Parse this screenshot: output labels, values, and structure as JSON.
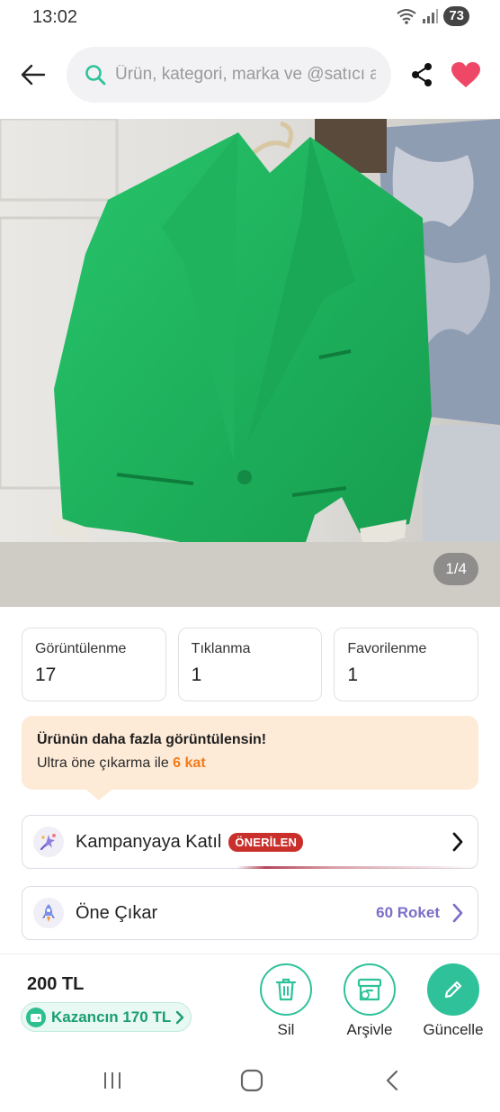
{
  "status_bar": {
    "time": "13:02",
    "battery": "73"
  },
  "header": {
    "search_placeholder": "Ürün, kategori, marka ve @satıcı ara"
  },
  "photo": {
    "counter": "1/4"
  },
  "stats": [
    {
      "label": "Görüntülenme",
      "value": "17"
    },
    {
      "label": "Tıklanma",
      "value": "1"
    },
    {
      "label": "Favorilenme",
      "value": "1"
    }
  ],
  "promo": {
    "title": "Ürünün daha fazla görüntülensin!",
    "subtitle_prefix": "Ultra öne çıkarma ile ",
    "subtitle_highlight": "6 kat"
  },
  "campaign": {
    "label": "Kampanyaya Katıl",
    "badge": "ÖNERİLEN"
  },
  "boost": {
    "label": "Öne Çıkar",
    "value": "60 Roket"
  },
  "bottom": {
    "price": "200 TL",
    "earnings": "Kazancın 170 TL",
    "actions": {
      "delete": "Sil",
      "archive": "Arşivle",
      "update": "Güncelle"
    }
  },
  "colors": {
    "accent": "#2fc29a",
    "highlight": "#f27a1a",
    "badge": "#c9302c",
    "heart": "#ef4766",
    "boost_text": "#7a6fc8",
    "promo_bg": "#fdebd7"
  },
  "icons": [
    "back-arrow-icon",
    "search-icon",
    "share-icon",
    "heart-icon",
    "campaign-icon",
    "rocket-icon",
    "chevron-right-icon",
    "wallet-icon",
    "trash-icon",
    "archive-icon",
    "pencil-icon",
    "recents-icon",
    "home-icon",
    "back-nav-icon"
  ]
}
